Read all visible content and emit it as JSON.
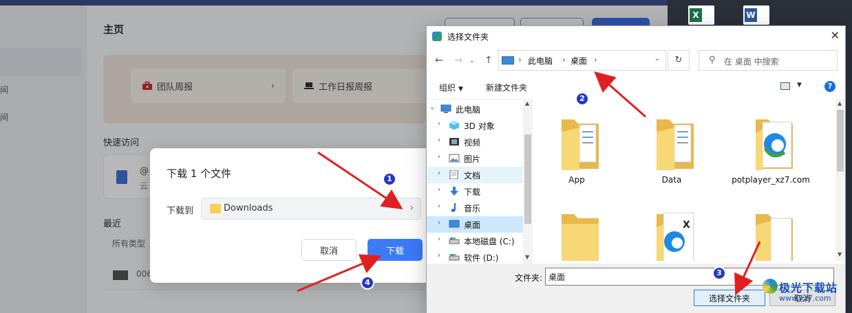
{
  "background": {
    "page_title": "主页",
    "cards": [
      {
        "label": "团队周报",
        "icon": "briefcase-icon"
      },
      {
        "label": "工作日报周报",
        "icon": "laptop-icon"
      }
    ],
    "quick_access_title": "快速访问",
    "quick_access_item": {
      "title": "@",
      "subtitle": "云"
    },
    "recent_title": "最近",
    "filter_label": "所有类型",
    "recent_row_text": "006",
    "leftnav_stubs": [
      "间",
      "间"
    ]
  },
  "download_dialog": {
    "title": "下载 1 个文件",
    "download_to_label": "下载到",
    "path": "Downloads",
    "cancel_label": "取消",
    "download_label": "下载"
  },
  "folder_picker": {
    "title": "选择文件夹",
    "breadcrumb": [
      "此电脑",
      "桌面"
    ],
    "refresh_glyph": "↻",
    "search_placeholder": "在 桌面 中搜索",
    "toolbar": {
      "organize": "组织",
      "new_folder": "新建文件夹",
      "help": "?"
    },
    "tree": [
      {
        "label": "此电脑",
        "icon": "computer-icon",
        "expander": "⌄",
        "level": 0,
        "state": ""
      },
      {
        "label": "3D 对象",
        "icon": "cube-3d-icon",
        "expander": "›",
        "level": 1,
        "state": ""
      },
      {
        "label": "视频",
        "icon": "video-icon",
        "expander": "›",
        "level": 1,
        "state": ""
      },
      {
        "label": "图片",
        "icon": "picture-icon",
        "expander": "›",
        "level": 1,
        "state": ""
      },
      {
        "label": "文档",
        "icon": "document-icon",
        "expander": "›",
        "level": 1,
        "state": "hover"
      },
      {
        "label": "下载",
        "icon": "download-arrow-icon",
        "expander": "›",
        "level": 1,
        "state": ""
      },
      {
        "label": "音乐",
        "icon": "music-note-icon",
        "expander": "›",
        "level": 1,
        "state": ""
      },
      {
        "label": "桌面",
        "icon": "desktop-icon",
        "expander": "›",
        "level": 1,
        "state": "selected"
      },
      {
        "label": "本地磁盘 (C:)",
        "icon": "drive-icon",
        "expander": "›",
        "level": 1,
        "state": ""
      },
      {
        "label": "软件 (D:)",
        "icon": "drive-icon",
        "expander": "›",
        "level": 1,
        "state": ""
      }
    ],
    "files": [
      {
        "name": "App",
        "type": "folder-docs"
      },
      {
        "name": "Data",
        "type": "folder-docs"
      },
      {
        "name": "potplayer_xz7.com",
        "type": "folder-edge"
      },
      {
        "name": "",
        "type": "folder-plain"
      },
      {
        "name": "",
        "type": "folder-edge-x"
      },
      {
        "name": "",
        "type": "folder-paper"
      }
    ],
    "folder_label": "文件夹:",
    "folder_value": "桌面",
    "select_button": "选择文件夹",
    "cancel_button": "取消"
  },
  "annotations": {
    "badges": [
      "1",
      "2",
      "3",
      "4"
    ],
    "arrow_color": "#e02020",
    "badge_color": "#2438c8"
  },
  "watermark": {
    "name": "极光下载站",
    "url": "www.xz7.com"
  },
  "dock_icons": [
    "excel-icon",
    "word-icon"
  ]
}
